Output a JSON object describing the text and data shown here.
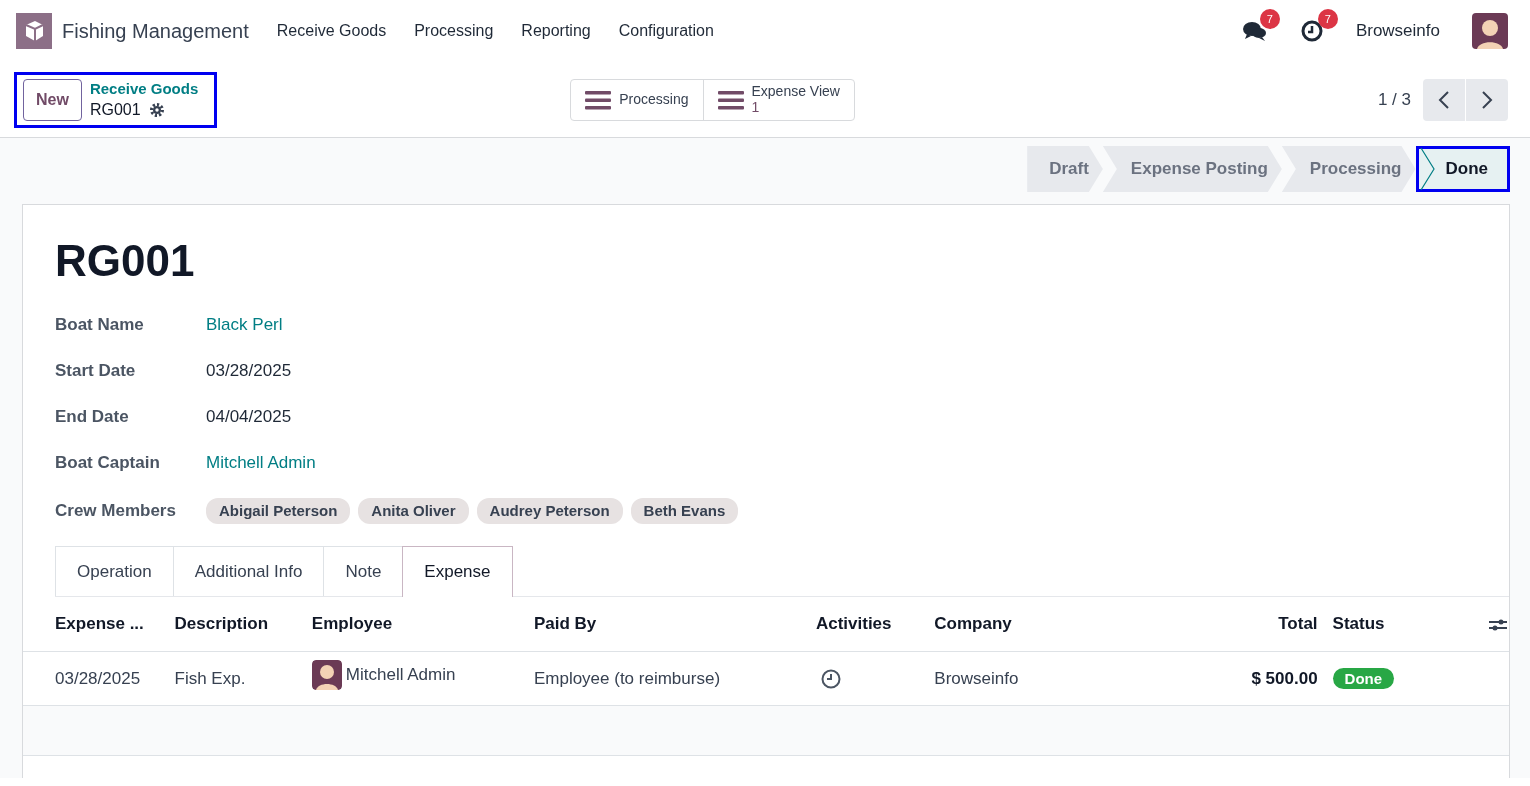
{
  "navbar": {
    "app_name": "Fishing Management",
    "menu": [
      "Receive Goods",
      "Processing",
      "Reporting",
      "Configuration"
    ],
    "messages_count": "7",
    "activities_count": "7",
    "company": "Browseinfo"
  },
  "control_panel": {
    "new_button": "New",
    "breadcrumb": "Receive Goods",
    "record": "RG001",
    "highlighted": true,
    "smart_buttons": [
      {
        "label": "Processing"
      },
      {
        "label": "Expense View",
        "count": "1"
      }
    ],
    "pager": "1 / 3"
  },
  "stages": [
    {
      "label": "Draft",
      "selected": false,
      "highlighted": false
    },
    {
      "label": "Expense Posting",
      "selected": false,
      "highlighted": false
    },
    {
      "label": "Processing",
      "selected": false,
      "highlighted": false
    },
    {
      "label": "Done",
      "selected": true,
      "highlighted": true
    }
  ],
  "form": {
    "title": "RG001",
    "fields": [
      {
        "label": "Boat Name",
        "value": "Black Perl",
        "kind": "link"
      },
      {
        "label": "Start Date",
        "value": "03/28/2025",
        "kind": "text"
      },
      {
        "label": "End Date",
        "value": "04/04/2025",
        "kind": "text"
      },
      {
        "label": "Boat Captain",
        "value": "Mitchell Admin",
        "kind": "link"
      },
      {
        "label": "Crew Members",
        "kind": "tags",
        "tags": [
          "Abigail Peterson",
          "Anita Oliver",
          "Audrey Peterson",
          "Beth Evans"
        ]
      }
    ],
    "tabs": [
      {
        "label": "Operation",
        "selected": false
      },
      {
        "label": "Additional Info",
        "selected": false
      },
      {
        "label": "Note",
        "selected": false
      },
      {
        "label": "Expense",
        "selected": true
      }
    ],
    "table": {
      "columns": [
        "Expense ...",
        "Description",
        "Employee",
        "Paid By",
        "Activities",
        "Company",
        "Total",
        "Status"
      ],
      "rows": [
        {
          "date": "03/28/2025",
          "description": "Fish Exp.",
          "employee": "Mitchell Admin",
          "paid_by": "Employee (to reimburse)",
          "company": "Browseinfo",
          "total": "$ 500.00",
          "status": "Done"
        }
      ]
    }
  }
}
